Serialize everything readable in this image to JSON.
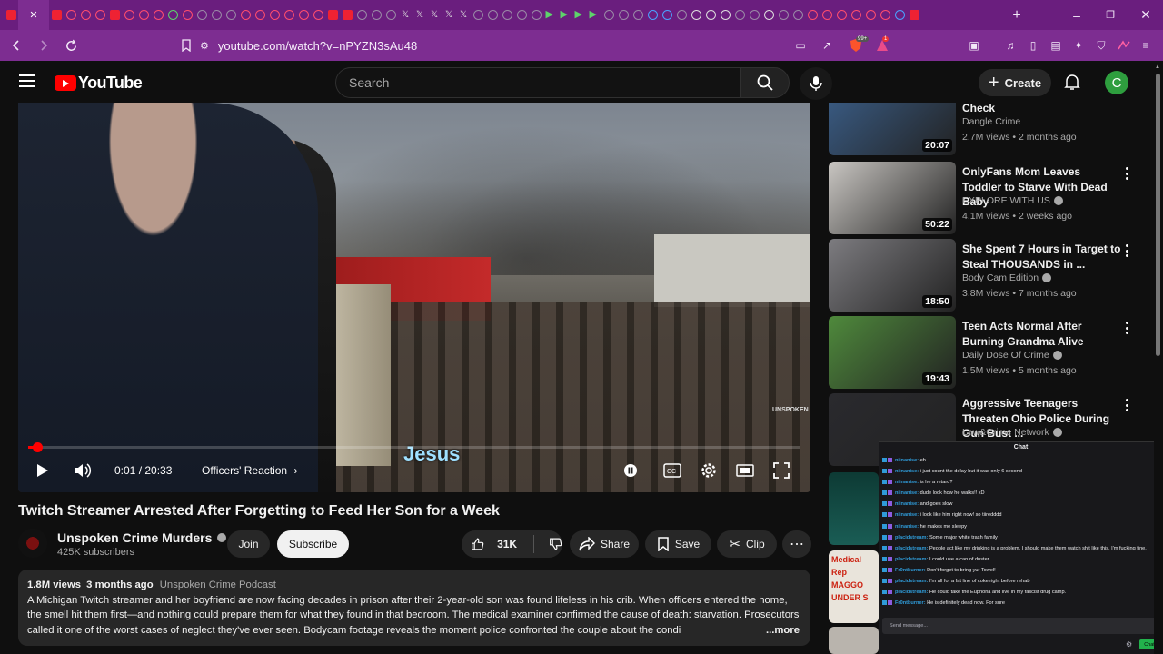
{
  "browser": {
    "url": "youtube.com/watch?v=nPYZN3sAu48",
    "new_tab": "+",
    "minimize": "–",
    "maximize": "❐",
    "close": "✕",
    "active_tab_close": "✕",
    "brave_badge": "99+",
    "alert_badge": "1",
    "favicons": [
      "play-red",
      "circle-red",
      "circle-red",
      "circle-red",
      "play-red",
      "circle-red",
      "circle-red",
      "circle-red",
      "green",
      "circle-red",
      "grey",
      "grey",
      "grey",
      "circle-red",
      "circle-red",
      "circle-red",
      "circle-red",
      "circle-red",
      "circle-red",
      "play-red",
      "play-red",
      "grey",
      "grey",
      "grey",
      "x",
      "x",
      "x",
      "x",
      "x",
      "grey",
      "grey",
      "grey",
      "grey",
      "grey",
      "play-green",
      "play-green",
      "play-green",
      "play-green",
      "grey",
      "grey",
      "grey",
      "blue",
      "blue",
      "grey",
      "white",
      "white",
      "white",
      "grey",
      "grey",
      "white",
      "grey",
      "grey",
      "circle-red",
      "circle-red",
      "circle-red",
      "circle-red",
      "circle-red",
      "circle-red",
      "blue",
      "fill"
    ]
  },
  "youtube": {
    "logo_text": "YouTube",
    "search_placeholder": "Search",
    "create_label": "Create",
    "avatar_letter": "C"
  },
  "player": {
    "time": "0:01 / 20:33",
    "chapter": "Officers' Reaction",
    "caption": "Jesus",
    "watermark": "UNSPOKEN",
    "progress_fraction": 0.012
  },
  "video": {
    "title": "Twitch Streamer Arrested After Forgetting to Feed Her Son for a Week",
    "channel": "Unspoken Crime Murders",
    "subscribers": "425K subscribers",
    "join_label": "Join",
    "subscribe_label": "Subscribe",
    "likes": "31K",
    "share_label": "Share",
    "save_label": "Save",
    "clip_label": "Clip"
  },
  "description": {
    "views": "1.8M views",
    "age": "3 months ago",
    "tag": "Unspoken Crime Podcast",
    "text": "A Michigan Twitch streamer and her boyfriend are now facing decades in prison after their 2-year-old son was found lifeless in his crib. When officers entered the home, the smell hit them first—and nothing could prepare them for what they found in that bedroom. The medical examiner confirmed the cause of death: starvation. Prosecutors called it one of the worst cases of neglect they've ever seen. Bodycam footage reveals the moment police confronted the couple about the condi",
    "more_label": "...more"
  },
  "sidebar": {
    "items": [
      {
        "title": "in Freezer During Welfare Check",
        "channel": "Dangle Crime",
        "meta": "2.7M views • 2 months ago",
        "duration": "20:07",
        "verified": false,
        "thumb_color": "#3b5f8a"
      },
      {
        "title": "OnlyFans Mom Leaves Toddler to Starve With Dead Baby",
        "channel": "EXPLORE WITH US",
        "meta": "4.1M views • 2 weeks ago",
        "duration": "50:22",
        "verified": true,
        "thumb_color": "#c9c6c2"
      },
      {
        "title": "She Spent 7 Hours in Target to Steal THOUSANDS in ...",
        "channel": "Body Cam Edition",
        "meta": "3.8M views • 7 months ago",
        "duration": "18:50",
        "verified": true,
        "thumb_color": "#7d7c80"
      },
      {
        "title": "Teen Acts Normal After Burning Grandma Alive",
        "channel": "Daily Dose Of Crime",
        "meta": "1.5M views • 5 months ago",
        "duration": "19:43",
        "verified": true,
        "thumb_color": "#4f8a3c"
      },
      {
        "title": "Aggressive Teenagers Threaten Ohio Police During Gun Bust ...",
        "channel": "Law&Crime Network",
        "meta": "",
        "duration": "",
        "verified": true,
        "thumb_color": "#2a2a2e"
      }
    ],
    "extra_thumb_text": "Medical Rep MAGGO UNDER S"
  },
  "chat": {
    "header": "Chat",
    "lines": [
      {
        "user": "niinanise:",
        "text": "eh",
        "color": "#2f9bd8"
      },
      {
        "user": "niinanise:",
        "text": "i just count the delay but it was only 6 second",
        "color": "#2f9bd8"
      },
      {
        "user": "niinanise:",
        "text": "is he a retard?",
        "color": "#2f9bd8"
      },
      {
        "user": "niinanise:",
        "text": "dude look how he walks!! xD",
        "color": "#2f9bd8"
      },
      {
        "user": "niinanise:",
        "text": "and goes slow",
        "color": "#2f9bd8"
      },
      {
        "user": "niinanise:",
        "text": "i look like him right now! so tiiredddd",
        "color": "#2f9bd8"
      },
      {
        "user": "niinanise:",
        "text": "he makes me sleepy",
        "color": "#2f9bd8"
      },
      {
        "user": "placidstream:",
        "text": "Some major white trash family",
        "color": "#2f9bd8"
      },
      {
        "user": "placidstream:",
        "text": "People act like my drinking is a problem. I should make them watch shit like this. I'm fucking fine.",
        "color": "#2f9bd8"
      },
      {
        "user": "placidstream:",
        "text": "I could use a can of duster",
        "color": "#2f9bd8"
      },
      {
        "user": "Fr0ntburner:",
        "text": "Don't forget to bring yur Towel!",
        "color": "#2f9bd8"
      },
      {
        "user": "placidstream:",
        "text": "I'm all for a fat line of coke right before rehab",
        "color": "#2f9bd8"
      },
      {
        "user": "placidstream:",
        "text": "He could take the Euphoria and live in my fascist drug camp.",
        "color": "#2f9bd8"
      },
      {
        "user": "Fr0ntburner:",
        "text": "He is definitely dead now. For sure",
        "color": "#2f9bd8"
      }
    ],
    "input_placeholder": "Send message...",
    "send_label": "Chat"
  }
}
